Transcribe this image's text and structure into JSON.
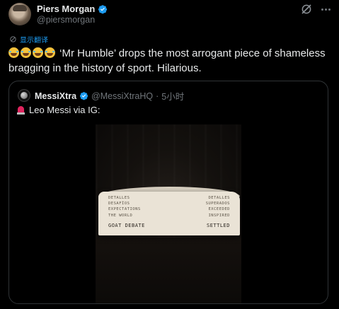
{
  "author": {
    "display_name": "Piers Morgan",
    "handle": "@piersmorgan",
    "verified": true,
    "avatar_icon": "profile-photo"
  },
  "actions": {
    "grok_icon": "grok-icon",
    "more_icon": "more-icon"
  },
  "translate": {
    "label": "显示翻译",
    "icon": "translate-icon"
  },
  "tweet": {
    "emojis": [
      "rofl-emoji",
      "rofl-emoji",
      "rofl-emoji",
      "rofl-emoji"
    ],
    "text": "‘Mr Humble’ drops the most arrogant piece of shameless bragging in the history of sport. Hilarious."
  },
  "quoted": {
    "display_name": "MessiXtra",
    "verified": true,
    "handle": "@MessiXtraHQ",
    "separator": "·",
    "time": "5小时",
    "siren_icon": "siren-icon",
    "text": "Leo Messi via IG:"
  },
  "media": {
    "paper_lines": [
      [
        "DETALLES",
        "DETALLES"
      ],
      [
        "DESAFÍOS",
        "SUPERADOS"
      ],
      [
        "EXPECTATIONS",
        "EXCEEDED"
      ],
      [
        "THE WORLD",
        "INSPIRED"
      ]
    ],
    "paper_main": [
      "GOAT DEBATE",
      "SETTLED"
    ]
  },
  "colors": {
    "background": "#000000",
    "text": "#e7e9ea",
    "secondary": "#71767b",
    "accent": "#1d9bf0",
    "border": "#2f3336"
  }
}
